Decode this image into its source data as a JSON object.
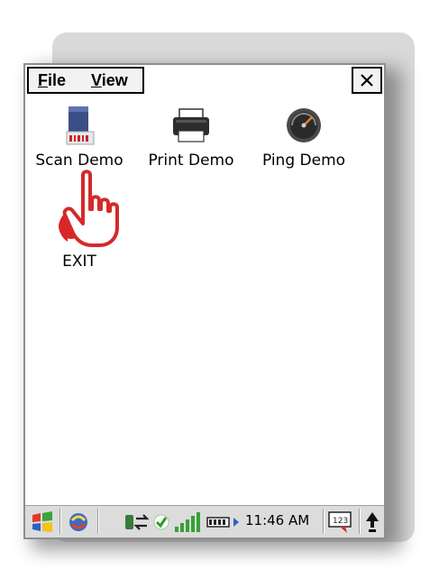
{
  "window": {
    "menu": {
      "file_label": "File",
      "file_mnemonic": "F",
      "file_rest": "ile",
      "view_label": "View",
      "view_mnemonic": "V",
      "view_rest": "iew"
    },
    "close_glyph": "×"
  },
  "desktop": {
    "icons": [
      {
        "label": "Scan Demo",
        "icon": "scanner-icon"
      },
      {
        "label": "Print Demo",
        "icon": "printer-icon"
      },
      {
        "label": "Ping Demo",
        "icon": "gauge-icon"
      },
      {
        "label": "EXIT",
        "icon": "exit-icon"
      }
    ],
    "pointer": "hand-pointer-icon"
  },
  "taskbar": {
    "start_icon": "windows-start-icon",
    "apps_icon": "apps-switcher-icon",
    "connectivity_icon": "activesync-icon",
    "check_icon": "check-icon",
    "signal_icon": "signal-bars-icon",
    "battery_icon": "battery-icon",
    "clock": "11:46 AM",
    "keyboard_icon": "keyboard-input-icon",
    "keyboard_text": "123",
    "up_arrow_icon": "up-arrow-icon",
    "colors": {
      "start_red": "#e23b2a",
      "start_green": "#3aa53a",
      "start_blue": "#2b62c8",
      "start_yellow": "#f3c21b",
      "signal_green": "#34a334"
    }
  }
}
